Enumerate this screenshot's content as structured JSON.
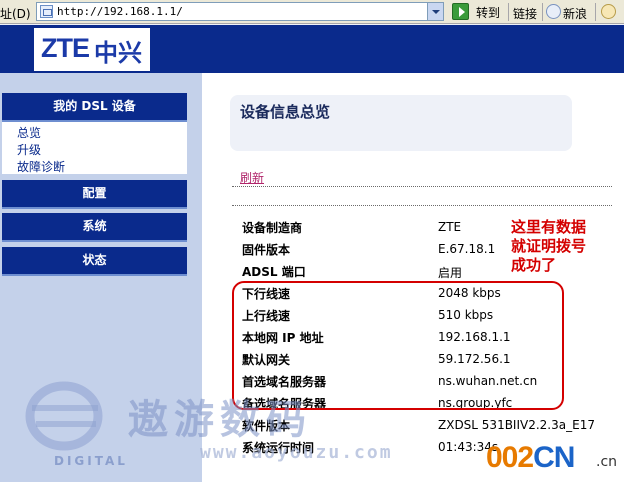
{
  "browser": {
    "address_label": "址(D)",
    "url": "http://192.168.1.1/",
    "go_label": "转到",
    "links_label": "链接",
    "sina_label": "新浪"
  },
  "header": {
    "logo_text": "ZTE",
    "logo_cn": "中兴"
  },
  "sidebar": {
    "groups": [
      {
        "label": "我的 DSL 设备"
      },
      {
        "label": "配置"
      },
      {
        "label": "系统"
      },
      {
        "label": "状态"
      }
    ],
    "sub_items": [
      "总览",
      "升级",
      "故障诊断"
    ]
  },
  "main": {
    "title": "设备信息总览",
    "refresh_label": "刷新",
    "rows": [
      {
        "label": "设备制造商",
        "value": "ZTE"
      },
      {
        "label": "固件版本",
        "value": "E.67.18.1"
      },
      {
        "label": "ADSL 端口",
        "value": "启用"
      },
      {
        "label": "下行线速",
        "value": "2048 kbps"
      },
      {
        "label": "上行线速",
        "value": "510 kbps"
      },
      {
        "label": "本地网 IP 地址",
        "value": "192.168.1.1"
      },
      {
        "label": "默认网关",
        "value": "59.172.56.1"
      },
      {
        "label": "首选域名服务器",
        "value": "ns.wuhan.net.cn"
      },
      {
        "label": "备选域名服务器",
        "value": "ns.group.yfc"
      },
      {
        "label": "软件版本",
        "value": "ZXDSL 531BIIV2.2.3a_E17"
      },
      {
        "label": "系统运行时间",
        "value": "01:43:34s"
      }
    ],
    "annotation_lines": [
      "这里有数据",
      "就证明拨号",
      "成功了"
    ]
  },
  "watermark": {
    "big_text": "遨游数码",
    "url_text": "www.aoyouzu.com",
    "digital_text": "DIGITAL",
    "site_a": "002",
    "site_b": "CN",
    "site_suffix": ".cn"
  },
  "colors": {
    "nav_blue": "#0a2a8c",
    "sidebar_bg": "#c4d1ea",
    "annotation_red": "#d40000",
    "refresh_link": "#b0246a"
  }
}
